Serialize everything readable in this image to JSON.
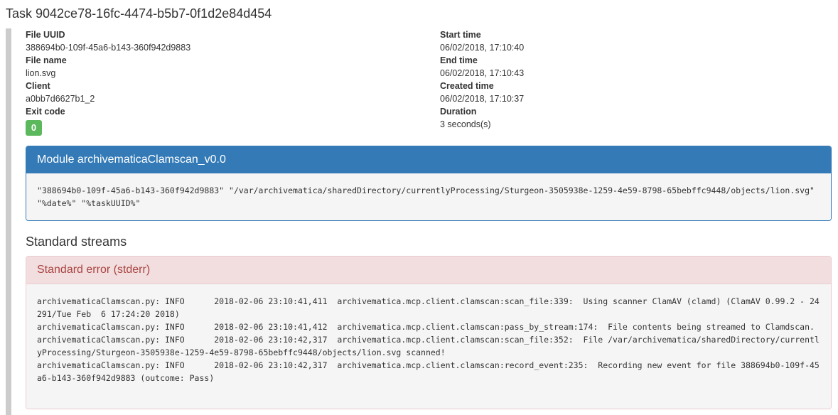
{
  "task": {
    "title": "Task 9042ce78-16fc-4474-b5b7-0f1d2e84d454"
  },
  "details": {
    "left": [
      {
        "label": "File UUID",
        "value": "388694b0-109f-45a6-b143-360f942d9883"
      },
      {
        "label": "File name",
        "value": "lion.svg"
      },
      {
        "label": "Client",
        "value": "a0bb7d6627b1_2"
      },
      {
        "label": "Exit code",
        "value": "0"
      }
    ],
    "right": [
      {
        "label": "Start time",
        "value": "06/02/2018, 17:10:40"
      },
      {
        "label": "End time",
        "value": "06/02/2018, 17:10:43"
      },
      {
        "label": "Created time",
        "value": "06/02/2018, 17:10:37"
      },
      {
        "label": "Duration",
        "value": "3 seconds(s)"
      }
    ]
  },
  "module": {
    "heading": "Module archivematicaClamscan_v0.0",
    "arguments": "\"388694b0-109f-45a6-b143-360f942d9883\" \"/var/archivematica/sharedDirectory/currentlyProcessing/Sturgeon-3505938e-1259-4e59-8798-65bebffc9448/objects/lion.svg\" \"%date%\" \"%taskUUID%\""
  },
  "streams": {
    "title": "Standard streams",
    "stderr_heading": "Standard error (stderr)",
    "stderr_text": "archivematicaClamscan.py: INFO      2018-02-06 23:10:41,411  archivematica.mcp.client.clamscan:scan_file:339:  Using scanner ClamAV (clamd) (ClamAV 0.99.2 - 24291/Tue Feb  6 17:24:20 2018)\narchivematicaClamscan.py: INFO      2018-02-06 23:10:41,412  archivematica.mcp.client.clamscan:pass_by_stream:174:  File contents being streamed to Clamdscan.\narchivematicaClamscan.py: INFO      2018-02-06 23:10:42,317  archivematica.mcp.client.clamscan:scan_file:352:  File /var/archivematica/sharedDirectory/currentlyProcessing/Sturgeon-3505938e-1259-4e59-8798-65bebffc9448/objects/lion.svg scanned!\narchivematicaClamscan.py: INFO      2018-02-06 23:10:42,317  archivematica.mcp.client.clamscan:record_event:235:  Recording new event for file 388694b0-109f-45a6-b143-360f942d9883 (outcome: Pass)"
  },
  "colors": {
    "primary": "#337ab7",
    "success": "#5cb85c",
    "danger_text": "#a94442",
    "danger_bg": "#f2dede"
  }
}
